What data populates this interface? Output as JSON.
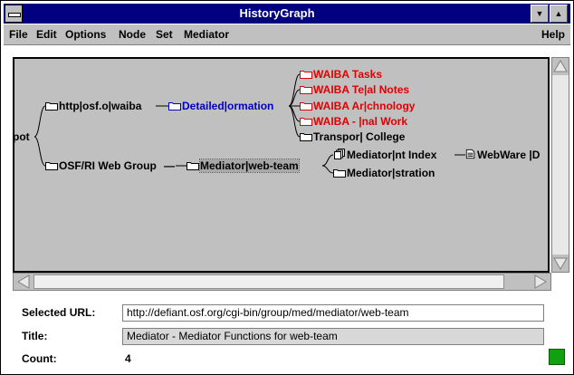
{
  "window": {
    "title": "HistoryGraph"
  },
  "menu": {
    "file": "File",
    "edit": "Edit",
    "options": "Options",
    "node": "Node",
    "set": "Set",
    "mediator": "Mediator",
    "help": "Help"
  },
  "graph": {
    "root": "pot",
    "http_node": "http|osf.o|waiba",
    "detailed_node": "Detailed|ormation",
    "waiba_tasks": "WAIBA Tasks",
    "waiba_technical": "WAIBA Te|al Notes",
    "waiba_archaeology": "WAIBA Ar|chnology",
    "waiba_final": "WAIBA - |nal Work",
    "transport": "Transpor| College",
    "osf_group": "OSF/RI Web Group",
    "mediator_web_team": "Mediator|web-team",
    "mediator_index": "Mediator|nt Index",
    "webware": "WebWare |D",
    "mediator_stration": "Mediator|stration",
    "colors": {
      "red": "#e00000",
      "blue": "#0000c0",
      "black": "#000000"
    }
  },
  "info": {
    "url_label": "Selected URL:",
    "url_value": "http://defiant.osf.org/cgi-bin/group/med/mediator/web-team",
    "title_label": "Title:",
    "title_value": "Mediator - Mediator Functions for web-team",
    "count_label": "Count:",
    "count_value": "4"
  }
}
